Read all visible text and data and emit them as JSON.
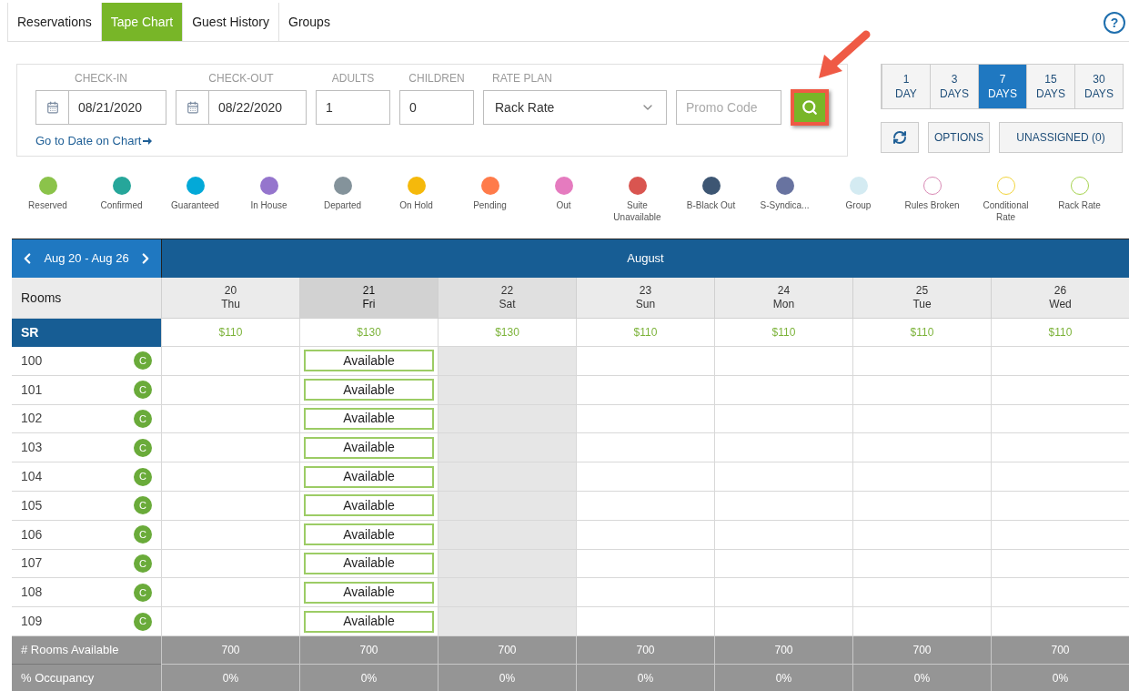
{
  "tabs": [
    {
      "label": "Reservations",
      "selected": false
    },
    {
      "label": "Tape Chart",
      "selected": true
    },
    {
      "label": "Guest History",
      "selected": false
    },
    {
      "label": "Groups",
      "selected": false
    }
  ],
  "help": "?",
  "search_form": {
    "check_in": {
      "label": "CHECK-IN",
      "value": "08/21/2020"
    },
    "check_out": {
      "label": "CHECK-OUT",
      "value": "08/22/2020"
    },
    "adults": {
      "label": "ADULTS",
      "value": "1"
    },
    "children": {
      "label": "CHILDREN",
      "value": "0"
    },
    "rate_plan": {
      "label": "RATE PLAN",
      "value": "Rack Rate"
    },
    "promo": {
      "placeholder": "Promo Code"
    },
    "go_to_date": "Go to Date on Chart",
    "search_highlighted": true
  },
  "view_ranges": [
    {
      "number": "1",
      "unit": "DAY",
      "selected": false
    },
    {
      "number": "3",
      "unit": "DAYS",
      "selected": false
    },
    {
      "number": "7",
      "unit": "DAYS",
      "selected": true
    },
    {
      "number": "15",
      "unit": "DAYS",
      "selected": false
    },
    {
      "number": "30",
      "unit": "DAYS",
      "selected": false
    }
  ],
  "actions": {
    "options": "OPTIONS",
    "unassigned": "UNASSIGNED (0)"
  },
  "legend": [
    {
      "label": "Reserved",
      "color": "#8bc34a",
      "kind": "filled"
    },
    {
      "label": "Confirmed",
      "color": "#26a69a",
      "kind": "filled"
    },
    {
      "label": "Guaranteed",
      "color": "#03a9d8",
      "kind": "filled"
    },
    {
      "label": "In House",
      "color": "#9575cd",
      "kind": "filled"
    },
    {
      "label": "Departed",
      "color": "#84939b",
      "kind": "filled"
    },
    {
      "label": "On Hold",
      "color": "#f5b90b",
      "kind": "filled"
    },
    {
      "label": "Pending",
      "color": "#ff7b4a",
      "kind": "filled"
    },
    {
      "label": "Out",
      "color": "#e57bbf",
      "kind": "filled"
    },
    {
      "label": "Suite Unavailable",
      "color": "#d95550",
      "kind": "filled"
    },
    {
      "label": "B-Black Out",
      "color": "#3d5673",
      "kind": "filled"
    },
    {
      "label": "S-Syndica...",
      "color": "#6873a0",
      "kind": "filled"
    },
    {
      "label": "Group",
      "color": "#d4ebf2",
      "kind": "filled"
    },
    {
      "label": "Rules Broken",
      "color": "#d98ab5",
      "kind": "ring"
    },
    {
      "label": "Conditional Rate",
      "color": "#f2d43b",
      "kind": "ring"
    },
    {
      "label": "Rack Rate",
      "color": "#a6d34f",
      "kind": "ring"
    }
  ],
  "chart": {
    "range": "Aug 20 - Aug 26",
    "month": "August",
    "rooms_heading": "Rooms",
    "room_type": "SR",
    "days": [
      {
        "date": "20",
        "weekday": "Thu",
        "rate": "$110",
        "selected": false,
        "shaded": false
      },
      {
        "date": "21",
        "weekday": "Fri",
        "rate": "$130",
        "selected": true,
        "shaded": false
      },
      {
        "date": "22",
        "weekday": "Sat",
        "rate": "$130",
        "selected": false,
        "shaded": true
      },
      {
        "date": "23",
        "weekday": "Sun",
        "rate": "$110",
        "selected": false,
        "shaded": false
      },
      {
        "date": "24",
        "weekday": "Mon",
        "rate": "$110",
        "selected": false,
        "shaded": false
      },
      {
        "date": "25",
        "weekday": "Tue",
        "rate": "$110",
        "selected": false,
        "shaded": false
      },
      {
        "date": "26",
        "weekday": "Wed",
        "rate": "$110",
        "selected": false,
        "shaded": false
      }
    ],
    "rooms": [
      {
        "name": "100",
        "badge": "C",
        "status": "Available"
      },
      {
        "name": "101",
        "badge": "C",
        "status": "Available"
      },
      {
        "name": "102",
        "badge": "C",
        "status": "Available"
      },
      {
        "name": "103",
        "badge": "C",
        "status": "Available"
      },
      {
        "name": "104",
        "badge": "C",
        "status": "Available"
      },
      {
        "name": "105",
        "badge": "C",
        "status": "Available"
      },
      {
        "name": "106",
        "badge": "C",
        "status": "Available"
      },
      {
        "name": "107",
        "badge": "C",
        "status": "Available"
      },
      {
        "name": "108",
        "badge": "C",
        "status": "Available"
      },
      {
        "name": "109",
        "badge": "C",
        "status": "Available"
      }
    ],
    "footer": [
      {
        "label": "# Rooms Available",
        "values": [
          "700",
          "700",
          "700",
          "700",
          "700",
          "700",
          "700"
        ]
      },
      {
        "label": "% Occupancy",
        "values": [
          "0%",
          "0%",
          "0%",
          "0%",
          "0%",
          "0%",
          "0%"
        ]
      }
    ]
  }
}
